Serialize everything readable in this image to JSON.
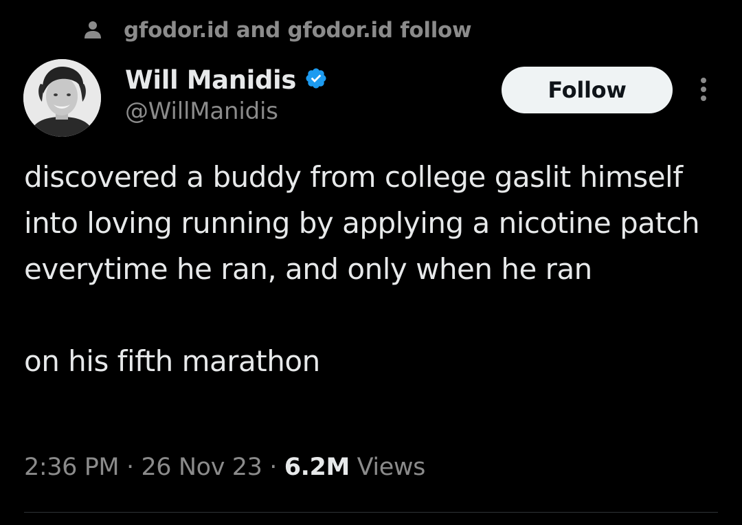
{
  "social_context": {
    "icon": "person-icon",
    "text": "gfodor.id and gfodor.id follow"
  },
  "author": {
    "display_name": "Will Manidis",
    "handle": "@WillManidis",
    "verified_badge_icon": "verified-badge-icon",
    "verified_color": "#1d9bf0"
  },
  "actions": {
    "follow_label": "Follow",
    "more_icon": "more-vertical-icon"
  },
  "tweet": {
    "paragraphs": [
      "discovered a buddy from college gaslit himself into loving running by applying a nicotine patch everytime he ran, and only when he ran",
      "on his fifth marathon"
    ]
  },
  "meta": {
    "time": "2:36 PM",
    "separator": "·",
    "date": "26 Nov 23",
    "views_count": "6.2M",
    "views_label": "Views"
  },
  "colors": {
    "background": "#000000",
    "primary_text": "#e7e9ea",
    "secondary_text": "#8b8b8b",
    "follow_button_bg": "#eff3f4",
    "follow_button_text": "#0f1419"
  }
}
